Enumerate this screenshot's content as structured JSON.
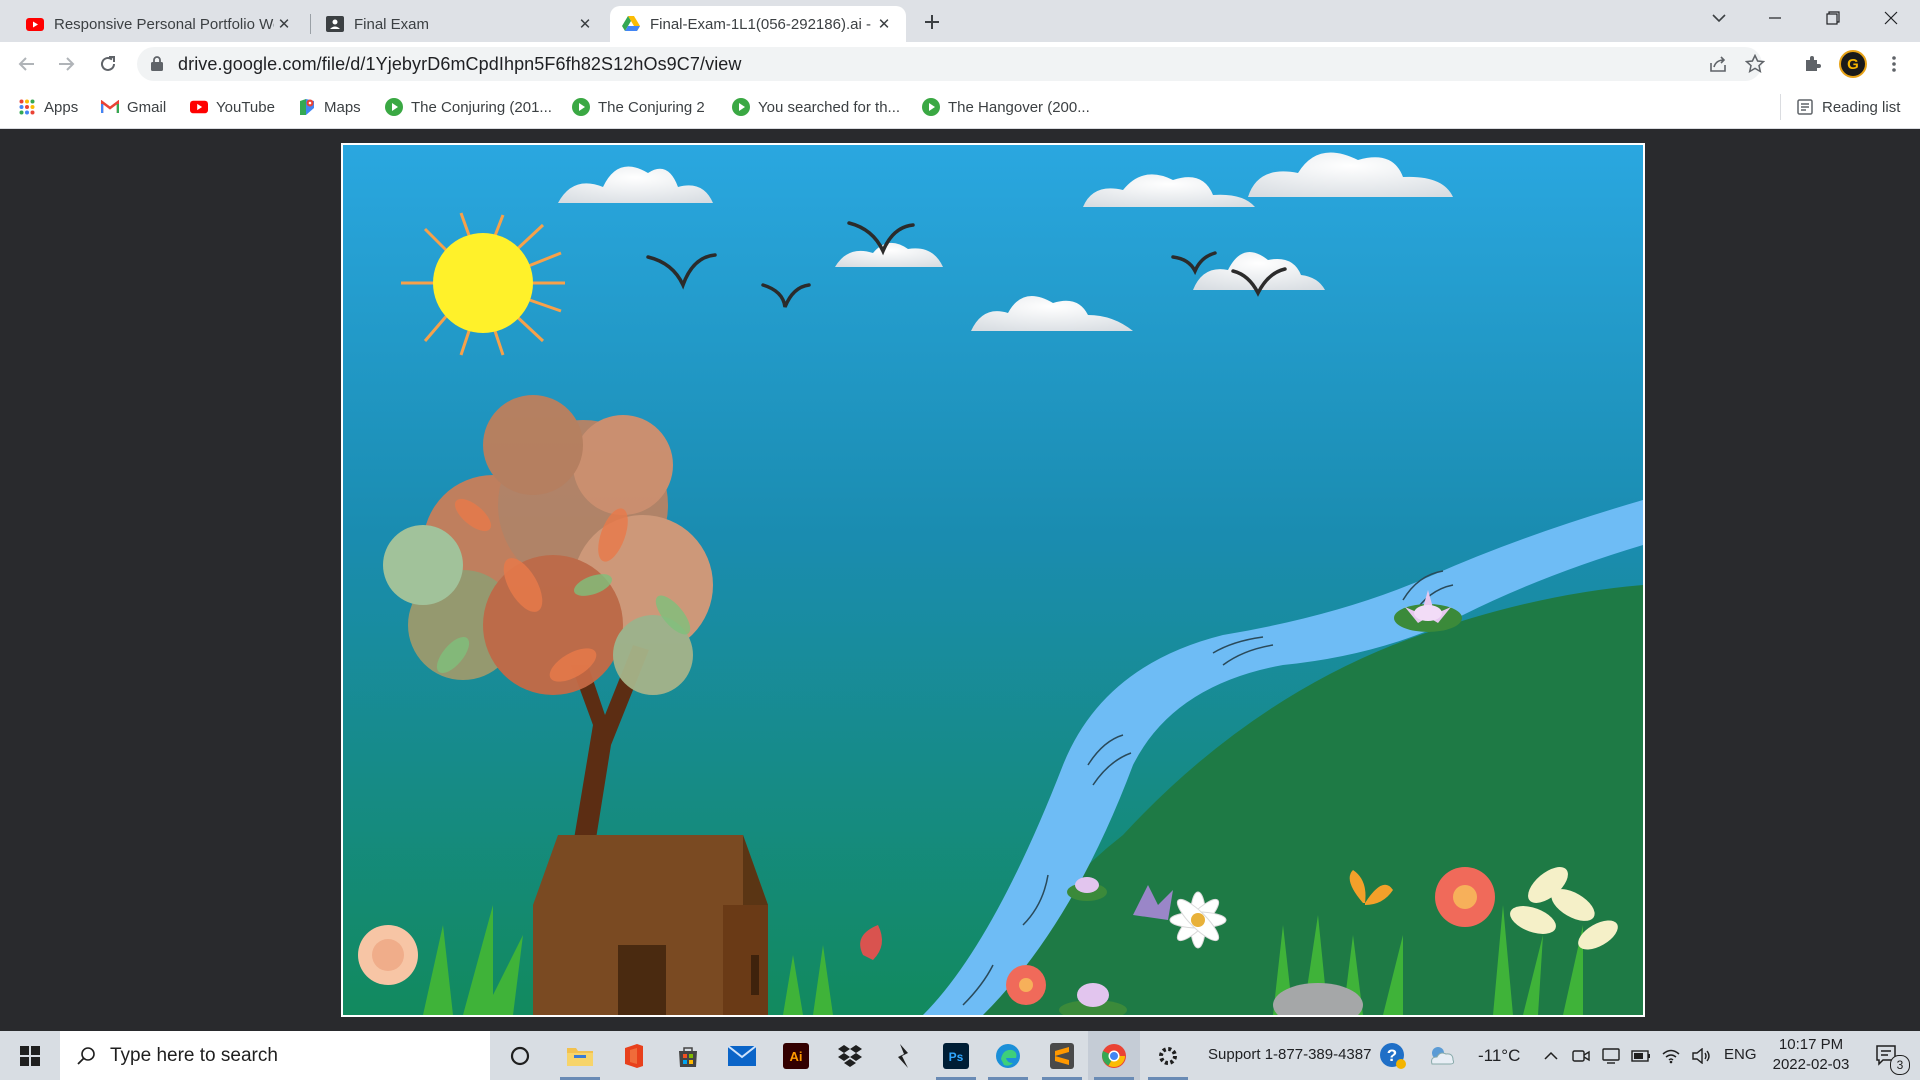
{
  "tabs": [
    {
      "title": "Responsive Personal Portfolio We",
      "icon": "youtube-icon",
      "active": false
    },
    {
      "title": "Final Exam",
      "icon": "classroom-icon",
      "active": false
    },
    {
      "title": "Final-Exam-1L1(056-292186).ai -",
      "icon": "google-drive-icon",
      "active": true
    }
  ],
  "address_bar": {
    "url": "drive.google.com/file/d/1YjebyrD6mCpdIhpn5F6fh82S12hOs9C7/view"
  },
  "bookmarks": {
    "items": [
      {
        "label": "Apps",
        "icon": "apps-grid-icon"
      },
      {
        "label": "Gmail",
        "icon": "gmail-icon"
      },
      {
        "label": "YouTube",
        "icon": "youtube-icon"
      },
      {
        "label": "Maps",
        "icon": "maps-icon"
      },
      {
        "label": "The Conjuring (201...",
        "icon": "play-icon"
      },
      {
        "label": "The Conjuring 2",
        "icon": "play-icon"
      },
      {
        "label": "You searched for th...",
        "icon": "play-icon"
      },
      {
        "label": "The Hangover (200...",
        "icon": "play-icon"
      }
    ],
    "reading_list": "Reading list"
  },
  "taskbar": {
    "search_placeholder": "Type here to search",
    "support_text": "Support 1-877-389-4387",
    "weather": "-11°C",
    "language": "ENG",
    "time": "10:17 PM",
    "date": "2022-02-03",
    "notification_count": "3"
  },
  "colors": {
    "sky_top": "#2aa7e0",
    "sky_bottom": "#138a62",
    "hill": "#1e7a45",
    "river": "#6ebcf5",
    "sun": "#fff12a",
    "house": "#7a4a22",
    "accent_blue": "#1a73e8"
  }
}
